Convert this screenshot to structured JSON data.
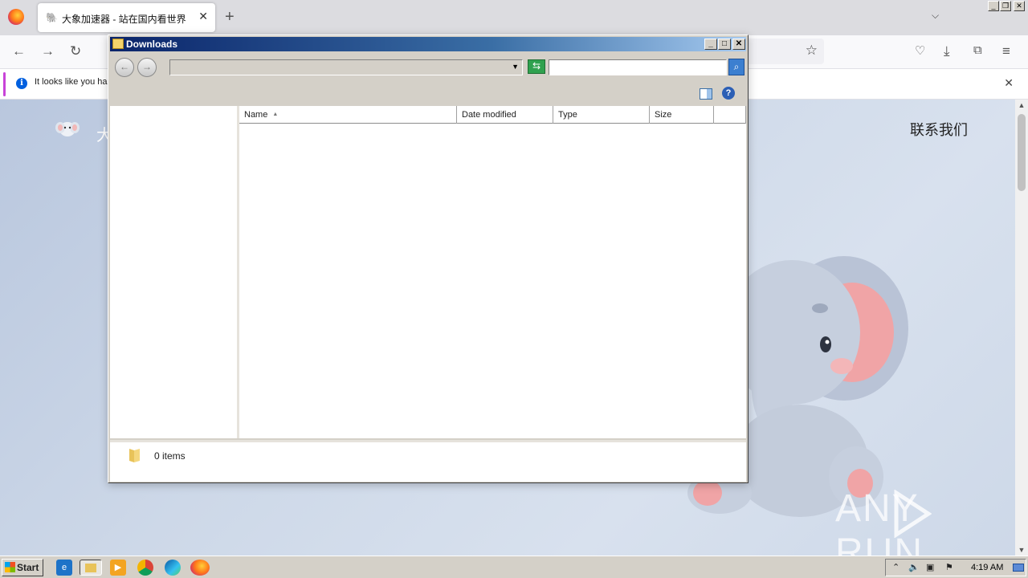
{
  "browser": {
    "tab": {
      "title": "大象加速器 - 站在国内看世界"
    },
    "notification": {
      "text": "It looks like you ha"
    }
  },
  "site": {
    "name_partial": "大",
    "contact_label": "联系我们",
    "watermark_text": "ANY RUN"
  },
  "explorer": {
    "title": "Downloads",
    "address_value": "",
    "search_value": "",
    "columns": [
      "Name",
      "Date modified",
      "Type",
      "Size"
    ],
    "sort_column": "Name",
    "status": "0 items"
  },
  "taskbar": {
    "start_label": "Start",
    "clock": "4:19 AM"
  },
  "colors": {
    "titlebar_start": "#0a246a",
    "titlebar_end": "#a6caf0",
    "page_bg": "#cdd8e8",
    "notification_accent": "#c843d8"
  }
}
